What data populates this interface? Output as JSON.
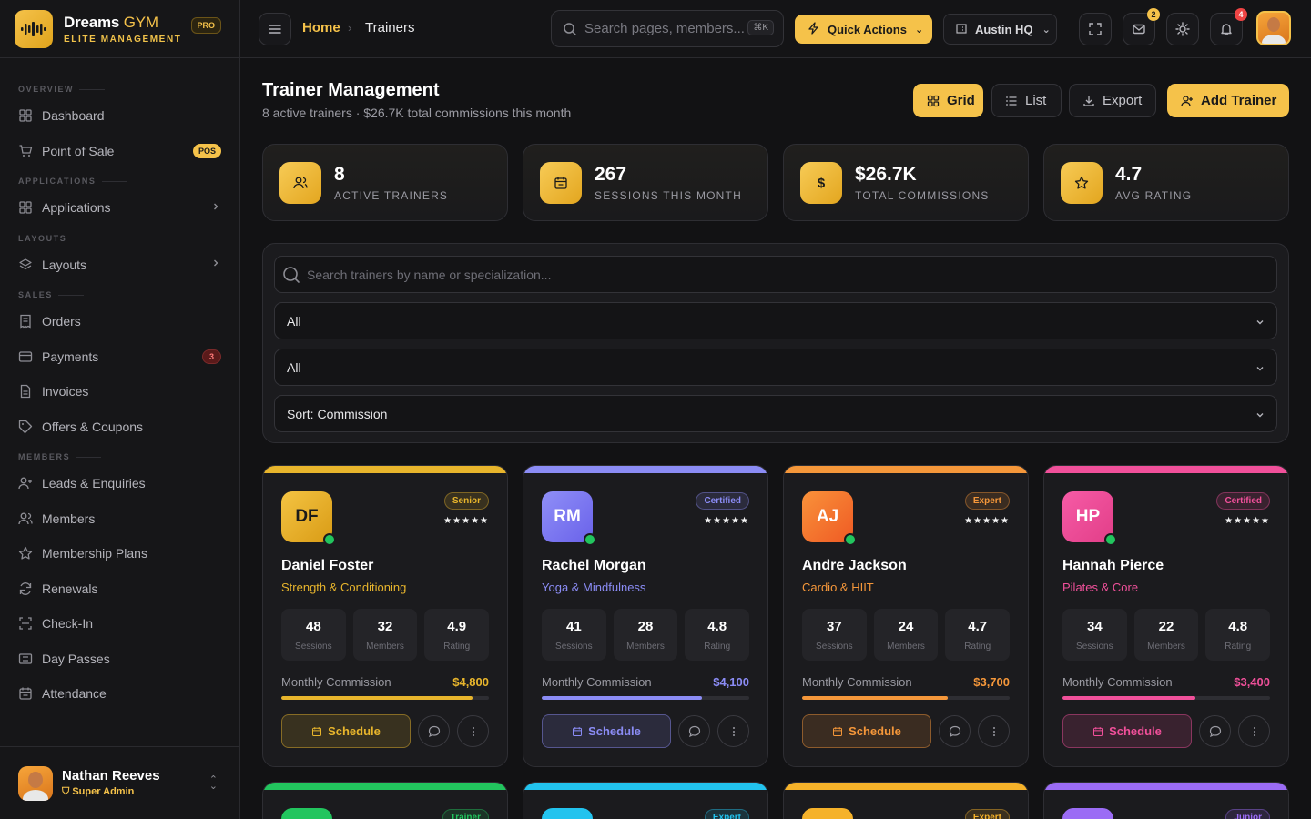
{
  "brand": {
    "name_main": "Dreams",
    "name_accent": "GYM",
    "tagline": "ELITE MANAGEMENT",
    "badge": "PRO"
  },
  "sidebar": {
    "sections": [
      {
        "title": "OVERVIEW",
        "items": [
          {
            "label": "Dashboard",
            "icon": "grid-icon"
          },
          {
            "label": "Point of Sale",
            "icon": "cart-icon",
            "badge": "POS"
          }
        ]
      },
      {
        "title": "APPLICATIONS",
        "items": [
          {
            "label": "Applications",
            "icon": "apps-icon",
            "chevron": true
          }
        ]
      },
      {
        "title": "LAYOUTS",
        "items": [
          {
            "label": "Layouts",
            "icon": "layers-icon",
            "chevron": true
          }
        ]
      },
      {
        "title": "SALES",
        "items": [
          {
            "label": "Orders",
            "icon": "receipt-icon"
          },
          {
            "label": "Payments",
            "icon": "card-icon",
            "count": "3"
          },
          {
            "label": "Invoices",
            "icon": "file-icon"
          },
          {
            "label": "Offers & Coupons",
            "icon": "tag-icon"
          }
        ]
      },
      {
        "title": "MEMBERS",
        "items": [
          {
            "label": "Leads & Enquiries",
            "icon": "user-plus-icon"
          },
          {
            "label": "Members",
            "icon": "users-icon"
          },
          {
            "label": "Membership Plans",
            "icon": "star-icon"
          },
          {
            "label": "Renewals",
            "icon": "refresh-icon"
          },
          {
            "label": "Check-In",
            "icon": "scan-icon"
          },
          {
            "label": "Day Passes",
            "icon": "ticket-icon"
          },
          {
            "label": "Attendance",
            "icon": "calendar-icon"
          }
        ]
      }
    ],
    "user": {
      "name": "Nathan Reeves",
      "role": "Super Admin"
    }
  },
  "topbar": {
    "breadcrumb_home": "Home",
    "breadcrumb_current": "Trainers",
    "search_placeholder": "Search pages, members...",
    "search_shortcut": "⌘K",
    "quick_actions": "Quick Actions",
    "branch": "Austin HQ",
    "mail_count": "2",
    "notif_count": "4"
  },
  "page": {
    "title": "Trainer Management",
    "subtitle": "8 active trainers · $26.7K total commissions this month",
    "buttons": {
      "grid": "Grid",
      "list": "List",
      "export": "Export",
      "add": "Add Trainer"
    }
  },
  "stats": [
    {
      "value": "8",
      "label": "ACTIVE TRAINERS",
      "icon": "users-icon"
    },
    {
      "value": "267",
      "label": "SESSIONS THIS MONTH",
      "icon": "calendar-icon"
    },
    {
      "value": "$26.7K",
      "label": "TOTAL COMMISSIONS",
      "icon": "dollar-icon"
    },
    {
      "value": "4.7",
      "label": "AVG RATING",
      "icon": "star-icon"
    }
  ],
  "filters": {
    "search_placeholder": "Search trainers by name or specialization...",
    "filter1": "All",
    "filter2": "All",
    "sort": "Sort: Commission"
  },
  "trainers": [
    {
      "initials": "DF",
      "name": "Daniel Foster",
      "spec": "Strength & Conditioning",
      "level": "Senior",
      "stars": "★★★★★",
      "sessions": "48",
      "members": "32",
      "rating": "4.9",
      "commission_label": "Monthly Commission",
      "commission": "$4,800",
      "progress": 0.92,
      "color": "#e8b52c",
      "gradient": [
        "#f4c443",
        "#d99b15"
      ],
      "schedule": "Schedule"
    },
    {
      "initials": "RM",
      "name": "Rachel Morgan",
      "spec": "Yoga & Mindfulness",
      "level": "Certified",
      "stars": "★★★★★",
      "sessions": "41",
      "members": "28",
      "rating": "4.8",
      "commission_label": "Monthly Commission",
      "commission": "$4,100",
      "progress": 0.77,
      "color": "#8b8cf5",
      "gradient": [
        "#8f8ff7",
        "#6a62ea"
      ],
      "schedule": "Schedule"
    },
    {
      "initials": "AJ",
      "name": "Andre Jackson",
      "spec": "Cardio & HIIT",
      "level": "Expert",
      "stars": "★★★★★",
      "sessions": "37",
      "members": "24",
      "rating": "4.7",
      "commission_label": "Monthly Commission",
      "commission": "$3,700",
      "progress": 0.7,
      "color": "#f5973a",
      "gradient": [
        "#f9923a",
        "#ef5a24"
      ],
      "schedule": "Schedule"
    },
    {
      "initials": "HP",
      "name": "Hannah Pierce",
      "spec": "Pilates & Core",
      "level": "Certified",
      "stars": "★★★★★",
      "sessions": "34",
      "members": "22",
      "rating": "4.8",
      "commission_label": "Monthly Commission",
      "commission": "$3,400",
      "progress": 0.64,
      "color": "#f0509a",
      "gradient": [
        "#f65ba6",
        "#e23e88"
      ],
      "schedule": "Schedule"
    }
  ],
  "trainers_partial": [
    {
      "level": "Trainer",
      "color": "#22c55e"
    },
    {
      "level": "Expert",
      "color": "#22c3ee"
    },
    {
      "level": "Expert",
      "color": "#f5b22a"
    },
    {
      "level": "Junior",
      "color": "#9b6cf5"
    }
  ],
  "labels": {
    "sessions": "Sessions",
    "members": "Members",
    "rating": "Rating"
  }
}
